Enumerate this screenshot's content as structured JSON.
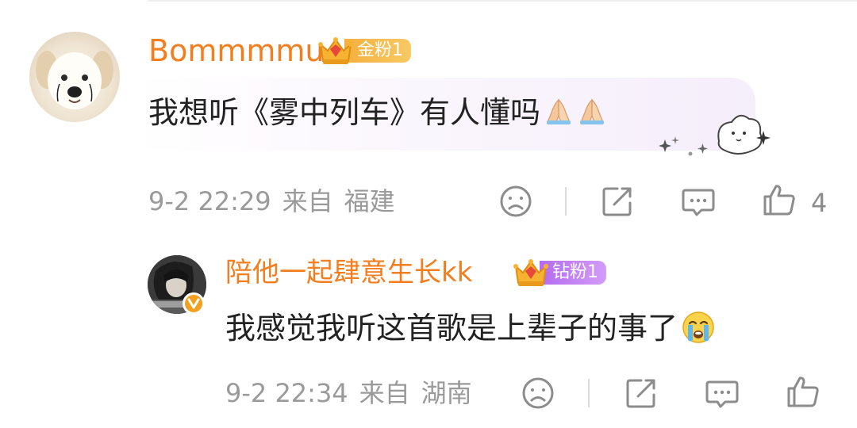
{
  "comment": {
    "username": "Bommmmu",
    "fan_badge": "金粉1",
    "text": "我想听《雾中列车》有人懂吗",
    "emoji": [
      "pray-emoji",
      "pray-emoji"
    ],
    "time": "9-2 22:29",
    "from_label": "来自",
    "location": "福建",
    "like_count": "4",
    "actions": [
      "sad-face-icon",
      "share-icon",
      "comment-icon",
      "like-icon"
    ]
  },
  "reply": {
    "username": "陪他一起肆意生长kk",
    "fan_badge": "钻粉1",
    "text": "我感觉我听这首歌是上辈子的事了",
    "emoji": [
      "crying-face-emoji"
    ],
    "time": "9-2 22:34",
    "from_label": "来自",
    "location": "湖南",
    "actions": [
      "sad-face-icon",
      "share-icon",
      "comment-icon",
      "like-icon"
    ]
  },
  "colors": {
    "username": "#f27e1f",
    "meta_text": "#9a9a9a",
    "gold_badge": "#f5b03c",
    "purple_badge": "#b46bf0",
    "vip_badge": "#f3a021"
  }
}
